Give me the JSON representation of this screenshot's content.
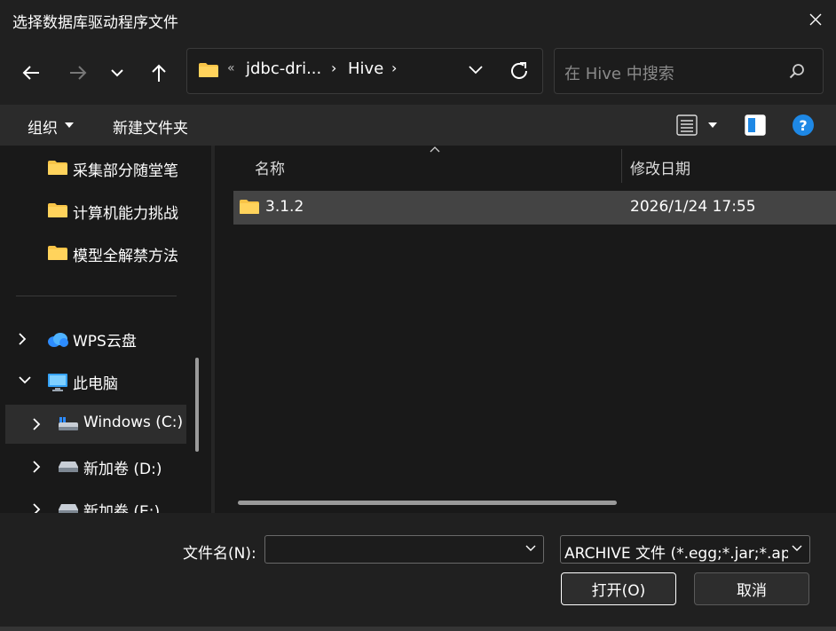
{
  "window": {
    "title": "选择数据库驱动程序文件"
  },
  "nav": {
    "overflow_marker": "«",
    "breadcrumbs": [
      "jdbc-dri...",
      "Hive"
    ],
    "search_placeholder": "在 Hive 中搜索"
  },
  "toolbar": {
    "organize_label": "组织",
    "new_folder_label": "新建文件夹"
  },
  "sidebar": {
    "items": [
      {
        "label": "采集部分随堂笔",
        "icon": "folder-icon"
      },
      {
        "label": "计算机能力挑战",
        "icon": "folder-icon"
      },
      {
        "label": "模型全解禁方法",
        "icon": "folder-icon"
      },
      {
        "label": "WPS云盘",
        "icon": "cloud-icon"
      },
      {
        "label": "此电脑",
        "icon": "computer-icon"
      },
      {
        "label": "Windows  (C:)",
        "icon": "drive-icon"
      },
      {
        "label": "新加卷 (D:)",
        "icon": "drive-icon"
      },
      {
        "label": "新加卷 (E:)",
        "icon": "drive-icon"
      }
    ]
  },
  "file_list": {
    "columns": [
      "名称",
      "修改日期"
    ],
    "rows": [
      {
        "name": "3.1.2",
        "modified": "2026/1/24 17:55",
        "icon": "folder-icon"
      }
    ]
  },
  "footer": {
    "filename_label": "文件名(N):",
    "filename_value": "",
    "filetype_value": "ARCHIVE 文件 (*.egg;*.jar;*.apk",
    "open_label": "打开(O)",
    "cancel_label": "取消"
  },
  "colors": {
    "background": "#202020",
    "pane": "#191919",
    "selected_row": "#444444",
    "help_blue": "#1e88e5",
    "folder_yellow": "#f8c447"
  }
}
